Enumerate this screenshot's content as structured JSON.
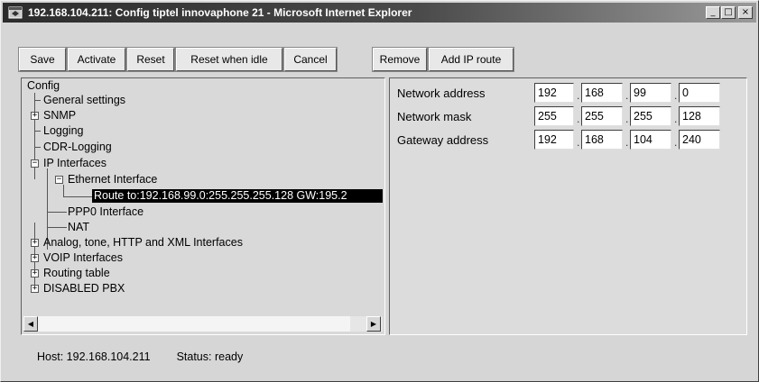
{
  "window": {
    "title": "192.168.104.211: Config tiptel innovaphone 21 - Microsoft Internet Explorer",
    "controls": {
      "minimize": "_",
      "maximize": "□",
      "close": "×"
    }
  },
  "toolbar": {
    "save": "Save",
    "activate": "Activate",
    "reset": "Reset",
    "reset_idle": "Reset when idle",
    "cancel": "Cancel",
    "remove": "Remove",
    "add_ip_route": "Add IP route"
  },
  "tree": {
    "root": "Config",
    "general": "General settings",
    "snmp": "SNMP",
    "logging": "Logging",
    "cdr": "CDR-Logging",
    "ip_interfaces": "IP Interfaces",
    "ethernet": "Ethernet Interface",
    "route": "Route to:192.168.99.0:255.255.255.128 GW:195.2",
    "ppp0": "PPP0 Interface",
    "nat": "NAT",
    "analog": "Analog, tone, HTTP and XML Interfaces",
    "voip": "VOIP Interfaces",
    "routing": "Routing table",
    "disabled_pbx": "DISABLED PBX"
  },
  "form": {
    "network_address": {
      "label": "Network address",
      "octets": [
        "192",
        "168",
        "99",
        "0"
      ]
    },
    "network_mask": {
      "label": "Network mask",
      "octets": [
        "255",
        "255",
        "255",
        "128"
      ]
    },
    "gateway_address": {
      "label": "Gateway address",
      "octets": [
        "192",
        "168",
        "104",
        "240"
      ]
    }
  },
  "status": {
    "host_label": "Host:",
    "host": "192.168.104.211",
    "status_label": "Status:",
    "status": "ready"
  },
  "icons": [
    "ie-window-icon",
    "minimize-icon",
    "maximize-icon",
    "close-icon",
    "expand-icon",
    "collapse-icon",
    "scroll-left-icon",
    "scroll-right-icon"
  ]
}
